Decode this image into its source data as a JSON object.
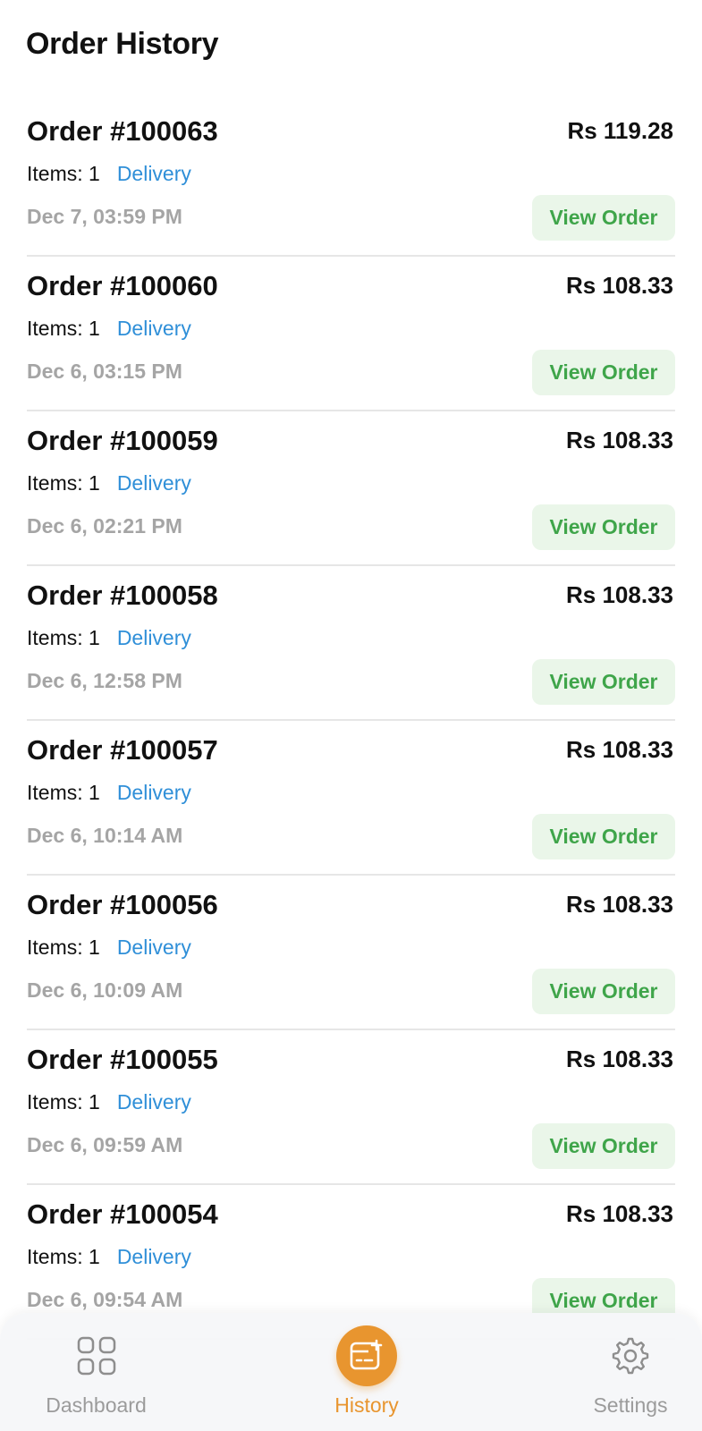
{
  "header": {
    "title": "Order History"
  },
  "orders": [
    {
      "id": "Order #100063",
      "price": "Rs 119.28",
      "items": "Items: 1",
      "type": "Delivery",
      "date": "Dec 7, 03:59 PM",
      "action": "View Order"
    },
    {
      "id": "Order #100060",
      "price": "Rs 108.33",
      "items": "Items: 1",
      "type": "Delivery",
      "date": "Dec 6, 03:15 PM",
      "action": "View Order"
    },
    {
      "id": "Order #100059",
      "price": "Rs 108.33",
      "items": "Items: 1",
      "type": "Delivery",
      "date": "Dec 6, 02:21 PM",
      "action": "View Order"
    },
    {
      "id": "Order #100058",
      "price": "Rs 108.33",
      "items": "Items: 1",
      "type": "Delivery",
      "date": "Dec 6, 12:58 PM",
      "action": "View Order"
    },
    {
      "id": "Order #100057",
      "price": "Rs 108.33",
      "items": "Items: 1",
      "type": "Delivery",
      "date": "Dec 6, 10:14 AM",
      "action": "View Order"
    },
    {
      "id": "Order #100056",
      "price": "Rs 108.33",
      "items": "Items: 1",
      "type": "Delivery",
      "date": "Dec 6, 10:09 AM",
      "action": "View Order"
    },
    {
      "id": "Order #100055",
      "price": "Rs 108.33",
      "items": "Items: 1",
      "type": "Delivery",
      "date": "Dec 6, 09:59 AM",
      "action": "View Order"
    },
    {
      "id": "Order #100054",
      "price": "Rs 108.33",
      "items": "Items: 1",
      "type": "Delivery",
      "date": "Dec 6, 09:54 AM",
      "action": "View Order"
    }
  ],
  "nav": {
    "items": [
      {
        "label": "Dashboard",
        "icon": "grid-icon",
        "active": false
      },
      {
        "label": "History",
        "icon": "receipt-icon",
        "active": true
      },
      {
        "label": "Settings",
        "icon": "gear-icon",
        "active": false
      }
    ]
  },
  "colors": {
    "accent": "#e8952f",
    "delivery": "#2f8fd8",
    "view_button_text": "#3fa54a",
    "view_button_bg": "#eaf6e9",
    "muted": "#a5a5a5"
  }
}
